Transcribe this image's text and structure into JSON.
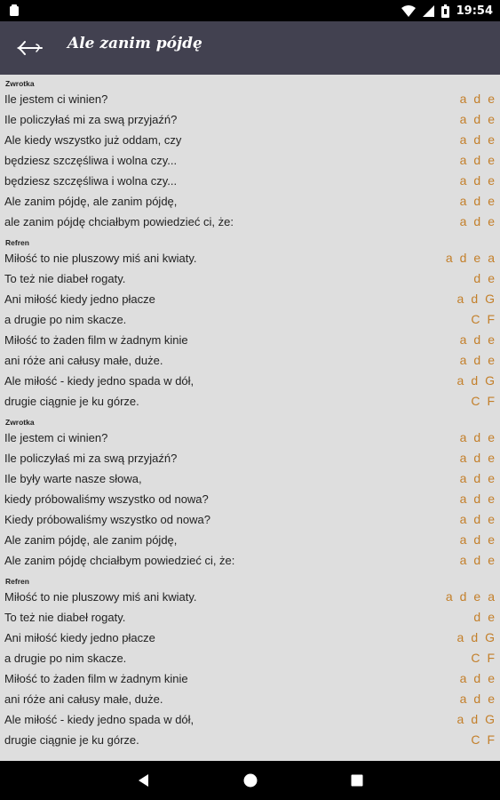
{
  "status_bar": {
    "time": "19:54",
    "icons": [
      "notification-icon",
      "wifi-icon",
      "signal-icon",
      "battery-icon"
    ]
  },
  "header": {
    "title": "Ale zanim pójdę",
    "back_icon": "back-arrow-icon"
  },
  "colors": {
    "app_bar": "#424150",
    "background": "#dedede",
    "chord": "#c37f2a"
  },
  "sections": [
    {
      "label": "Zwrotka",
      "lines": [
        {
          "text": "Ile jestem ci winien?",
          "chords": [
            "a",
            "d",
            "e"
          ]
        },
        {
          "text": "Ile policzyłaś mi za swą przyjaźń?",
          "chords": [
            "a",
            "d",
            "e"
          ]
        },
        {
          "text": "Ale kiedy wszystko już oddam, czy",
          "chords": [
            "a",
            "d",
            "e"
          ]
        },
        {
          "text": "będziesz szczęśliwa i wolna czy...",
          "chords": [
            "a",
            "d",
            "e"
          ]
        },
        {
          "text": "będziesz szczęśliwa i wolna czy...",
          "chords": [
            "a",
            "d",
            "e"
          ]
        },
        {
          "text": "Ale zanim pójdę, ale zanim pójdę,",
          "chords": [
            "a",
            "d",
            "e"
          ]
        },
        {
          "text": "ale zanim pójdę chciałbym powiedzieć ci, że:",
          "chords": [
            "a",
            "d",
            "e"
          ]
        }
      ]
    },
    {
      "label": "Refren",
      "lines": [
        {
          "text": "Miłość to nie pluszowy miś ani kwiaty.",
          "chords": [
            "a",
            "d",
            "e",
            "a"
          ]
        },
        {
          "text": "To też nie diabeł rogaty.",
          "chords": [
            "d",
            "e"
          ]
        },
        {
          "text": "Ani miłość kiedy jedno płacze",
          "chords": [
            "a",
            "d",
            "G"
          ]
        },
        {
          "text": "a drugie po nim skacze.",
          "chords": [
            "C",
            "F"
          ]
        },
        {
          "text": "Miłość to żaden film w żadnym kinie",
          "chords": [
            "a",
            "d",
            "e"
          ]
        },
        {
          "text": "ani róże ani całusy małe, duże.",
          "chords": [
            "a",
            "d",
            "e"
          ]
        },
        {
          "text": "Ale miłość - kiedy jedno spada w dół,",
          "chords": [
            "a",
            "d",
            "G"
          ]
        },
        {
          "text": "drugie ciągnie je ku górze.",
          "chords": [
            "C",
            "F"
          ]
        }
      ]
    },
    {
      "label": "Zwrotka",
      "lines": [
        {
          "text": "Ile jestem ci winien?",
          "chords": [
            "a",
            "d",
            "e"
          ]
        },
        {
          "text": "Ile policzyłaś mi za swą przyjaźń?",
          "chords": [
            "a",
            "d",
            "e"
          ]
        },
        {
          "text": "Ile były warte nasze słowa,",
          "chords": [
            "a",
            "d",
            "e"
          ]
        },
        {
          "text": "kiedy próbowaliśmy wszystko od nowa?",
          "chords": [
            "a",
            "d",
            "e"
          ]
        },
        {
          "text": "Kiedy próbowaliśmy wszystko od nowa?",
          "chords": [
            "a",
            "d",
            "e"
          ]
        },
        {
          "text": "Ale zanim pójdę, ale zanim pójdę,",
          "chords": [
            "a",
            "d",
            "e"
          ]
        },
        {
          "text": "Ale zanim pójdę chciałbym powiedzieć ci, że:",
          "chords": [
            "a",
            "d",
            "e"
          ]
        }
      ]
    },
    {
      "label": "Refren",
      "lines": [
        {
          "text": "Miłość to nie pluszowy miś ani kwiaty.",
          "chords": [
            "a",
            "d",
            "e",
            "a"
          ]
        },
        {
          "text": "To też nie diabeł rogaty.",
          "chords": [
            "d",
            "e"
          ]
        },
        {
          "text": "Ani miłość kiedy jedno płacze",
          "chords": [
            "a",
            "d",
            "G"
          ]
        },
        {
          "text": "a drugie po nim skacze.",
          "chords": [
            "C",
            "F"
          ]
        },
        {
          "text": "Miłość to żaden film w żadnym kinie",
          "chords": [
            "a",
            "d",
            "e"
          ]
        },
        {
          "text": "ani róże ani całusy małe, duże.",
          "chords": [
            "a",
            "d",
            "e"
          ]
        },
        {
          "text": "Ale miłość - kiedy jedno spada w dół,",
          "chords": [
            "a",
            "d",
            "G"
          ]
        },
        {
          "text": "drugie ciągnie je ku górze.",
          "chords": [
            "C",
            "F"
          ]
        }
      ]
    }
  ],
  "nav_bar": {
    "icons": [
      "back-triangle-icon",
      "home-circle-icon",
      "recents-square-icon"
    ]
  }
}
